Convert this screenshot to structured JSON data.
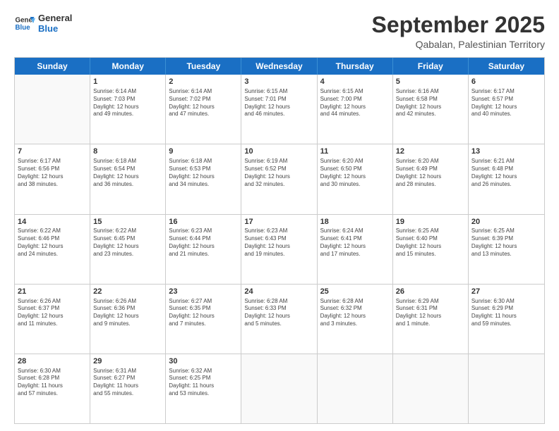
{
  "header": {
    "logo_line1": "General",
    "logo_line2": "Blue",
    "month": "September 2025",
    "location": "Qabalan, Palestinian Territory"
  },
  "weekdays": [
    "Sunday",
    "Monday",
    "Tuesday",
    "Wednesday",
    "Thursday",
    "Friday",
    "Saturday"
  ],
  "rows": [
    [
      {
        "day": "",
        "info": ""
      },
      {
        "day": "1",
        "info": "Sunrise: 6:14 AM\nSunset: 7:03 PM\nDaylight: 12 hours\nand 49 minutes."
      },
      {
        "day": "2",
        "info": "Sunrise: 6:14 AM\nSunset: 7:02 PM\nDaylight: 12 hours\nand 47 minutes."
      },
      {
        "day": "3",
        "info": "Sunrise: 6:15 AM\nSunset: 7:01 PM\nDaylight: 12 hours\nand 46 minutes."
      },
      {
        "day": "4",
        "info": "Sunrise: 6:15 AM\nSunset: 7:00 PM\nDaylight: 12 hours\nand 44 minutes."
      },
      {
        "day": "5",
        "info": "Sunrise: 6:16 AM\nSunset: 6:58 PM\nDaylight: 12 hours\nand 42 minutes."
      },
      {
        "day": "6",
        "info": "Sunrise: 6:17 AM\nSunset: 6:57 PM\nDaylight: 12 hours\nand 40 minutes."
      }
    ],
    [
      {
        "day": "7",
        "info": "Sunrise: 6:17 AM\nSunset: 6:56 PM\nDaylight: 12 hours\nand 38 minutes."
      },
      {
        "day": "8",
        "info": "Sunrise: 6:18 AM\nSunset: 6:54 PM\nDaylight: 12 hours\nand 36 minutes."
      },
      {
        "day": "9",
        "info": "Sunrise: 6:18 AM\nSunset: 6:53 PM\nDaylight: 12 hours\nand 34 minutes."
      },
      {
        "day": "10",
        "info": "Sunrise: 6:19 AM\nSunset: 6:52 PM\nDaylight: 12 hours\nand 32 minutes."
      },
      {
        "day": "11",
        "info": "Sunrise: 6:20 AM\nSunset: 6:50 PM\nDaylight: 12 hours\nand 30 minutes."
      },
      {
        "day": "12",
        "info": "Sunrise: 6:20 AM\nSunset: 6:49 PM\nDaylight: 12 hours\nand 28 minutes."
      },
      {
        "day": "13",
        "info": "Sunrise: 6:21 AM\nSunset: 6:48 PM\nDaylight: 12 hours\nand 26 minutes."
      }
    ],
    [
      {
        "day": "14",
        "info": "Sunrise: 6:22 AM\nSunset: 6:46 PM\nDaylight: 12 hours\nand 24 minutes."
      },
      {
        "day": "15",
        "info": "Sunrise: 6:22 AM\nSunset: 6:45 PM\nDaylight: 12 hours\nand 23 minutes."
      },
      {
        "day": "16",
        "info": "Sunrise: 6:23 AM\nSunset: 6:44 PM\nDaylight: 12 hours\nand 21 minutes."
      },
      {
        "day": "17",
        "info": "Sunrise: 6:23 AM\nSunset: 6:43 PM\nDaylight: 12 hours\nand 19 minutes."
      },
      {
        "day": "18",
        "info": "Sunrise: 6:24 AM\nSunset: 6:41 PM\nDaylight: 12 hours\nand 17 minutes."
      },
      {
        "day": "19",
        "info": "Sunrise: 6:25 AM\nSunset: 6:40 PM\nDaylight: 12 hours\nand 15 minutes."
      },
      {
        "day": "20",
        "info": "Sunrise: 6:25 AM\nSunset: 6:39 PM\nDaylight: 12 hours\nand 13 minutes."
      }
    ],
    [
      {
        "day": "21",
        "info": "Sunrise: 6:26 AM\nSunset: 6:37 PM\nDaylight: 12 hours\nand 11 minutes."
      },
      {
        "day": "22",
        "info": "Sunrise: 6:26 AM\nSunset: 6:36 PM\nDaylight: 12 hours\nand 9 minutes."
      },
      {
        "day": "23",
        "info": "Sunrise: 6:27 AM\nSunset: 6:35 PM\nDaylight: 12 hours\nand 7 minutes."
      },
      {
        "day": "24",
        "info": "Sunrise: 6:28 AM\nSunset: 6:33 PM\nDaylight: 12 hours\nand 5 minutes."
      },
      {
        "day": "25",
        "info": "Sunrise: 6:28 AM\nSunset: 6:32 PM\nDaylight: 12 hours\nand 3 minutes."
      },
      {
        "day": "26",
        "info": "Sunrise: 6:29 AM\nSunset: 6:31 PM\nDaylight: 12 hours\nand 1 minute."
      },
      {
        "day": "27",
        "info": "Sunrise: 6:30 AM\nSunset: 6:29 PM\nDaylight: 11 hours\nand 59 minutes."
      }
    ],
    [
      {
        "day": "28",
        "info": "Sunrise: 6:30 AM\nSunset: 6:28 PM\nDaylight: 11 hours\nand 57 minutes."
      },
      {
        "day": "29",
        "info": "Sunrise: 6:31 AM\nSunset: 6:27 PM\nDaylight: 11 hours\nand 55 minutes."
      },
      {
        "day": "30",
        "info": "Sunrise: 6:32 AM\nSunset: 6:25 PM\nDaylight: 11 hours\nand 53 minutes."
      },
      {
        "day": "",
        "info": ""
      },
      {
        "day": "",
        "info": ""
      },
      {
        "day": "",
        "info": ""
      },
      {
        "day": "",
        "info": ""
      }
    ]
  ]
}
